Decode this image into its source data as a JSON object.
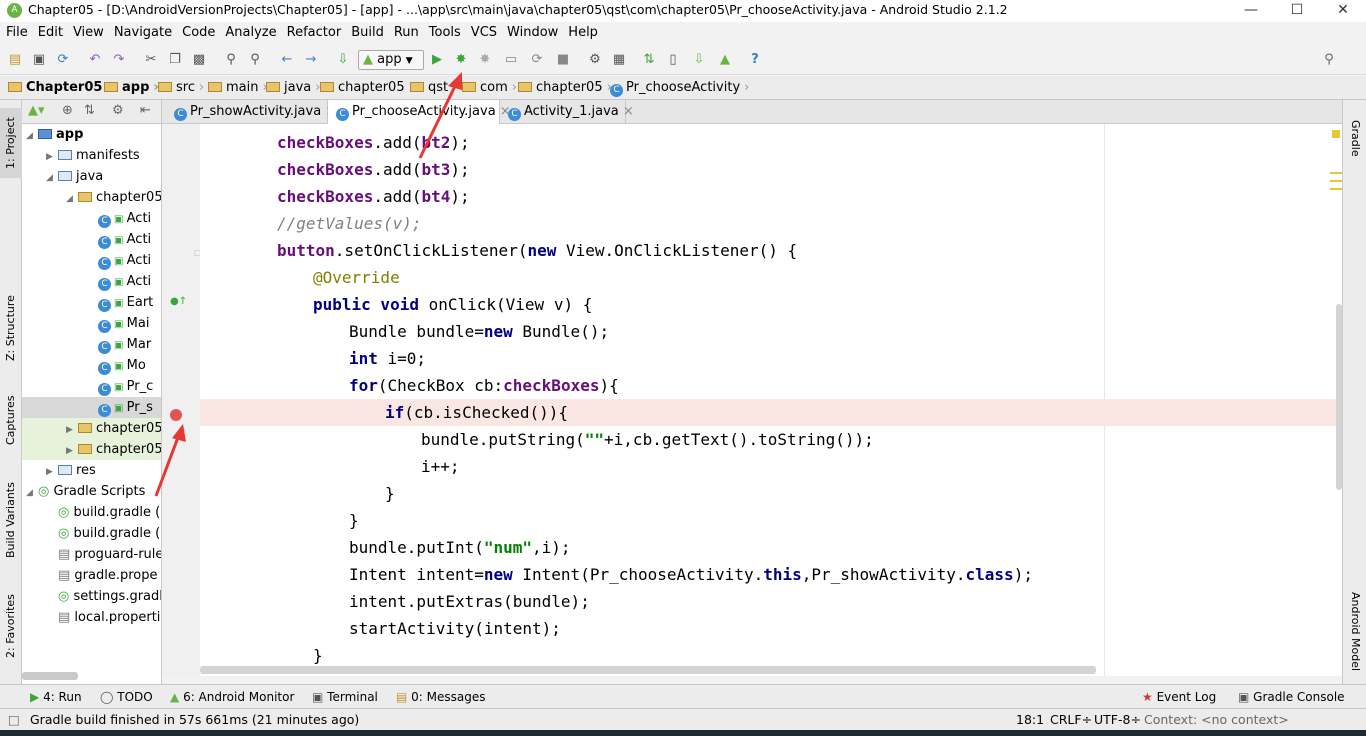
{
  "window": {
    "title": "Chapter05 - [D:\\AndroidVersionProjects\\Chapter05] - [app] - ...\\app\\src\\main\\java\\chapter05\\qst\\com\\chapter05\\Pr_chooseActivity.java - Android Studio 2.1.2",
    "minimize": "—",
    "maximize": "☐",
    "close": "✕"
  },
  "menu": [
    "File",
    "Edit",
    "View",
    "Navigate",
    "Code",
    "Analyze",
    "Refactor",
    "Build",
    "Run",
    "Tools",
    "VCS",
    "Window",
    "Help"
  ],
  "toolbar": {
    "run_config": "app"
  },
  "breadcrumb": [
    "Chapter05",
    "app",
    "src",
    "main",
    "java",
    "chapter05",
    "qst",
    "com",
    "chapter05",
    "Pr_chooseActivity"
  ],
  "left_tabs": [
    "1: Project",
    "Z: Structure",
    "Captures",
    "Build Variants",
    "2: Favorites"
  ],
  "right_tabs": [
    "Gradle",
    "Android Model"
  ],
  "project_tree": [
    {
      "label": "app",
      "depth": 0,
      "kind": "module",
      "expanded": true
    },
    {
      "label": "manifests",
      "depth": 1,
      "kind": "folder",
      "expanded": false
    },
    {
      "label": "java",
      "depth": 1,
      "kind": "folder",
      "expanded": true
    },
    {
      "label": "chapter05",
      "depth": 2,
      "kind": "package",
      "expanded": true
    },
    {
      "label": "Acti",
      "depth": 3,
      "kind": "class"
    },
    {
      "label": "Acti",
      "depth": 3,
      "kind": "class"
    },
    {
      "label": "Acti",
      "depth": 3,
      "kind": "class"
    },
    {
      "label": "Acti",
      "depth": 3,
      "kind": "class"
    },
    {
      "label": "Eart",
      "depth": 3,
      "kind": "class"
    },
    {
      "label": "Mai",
      "depth": 3,
      "kind": "class"
    },
    {
      "label": "Mar",
      "depth": 3,
      "kind": "class"
    },
    {
      "label": "Mo",
      "depth": 3,
      "kind": "class"
    },
    {
      "label": "Pr_c",
      "depth": 3,
      "kind": "class"
    },
    {
      "label": "Pr_s",
      "depth": 3,
      "kind": "class",
      "selected": true
    },
    {
      "label": "chapter05",
      "depth": 2,
      "kind": "package",
      "expanded": false
    },
    {
      "label": "chapter05",
      "depth": 2,
      "kind": "package",
      "expanded": false
    },
    {
      "label": "res",
      "depth": 1,
      "kind": "folder",
      "expanded": false
    },
    {
      "label": "Gradle Scripts",
      "depth": 0,
      "kind": "gradle",
      "expanded": true
    },
    {
      "label": "build.gradle (",
      "depth": 1,
      "kind": "gradlefile"
    },
    {
      "label": "build.gradle (",
      "depth": 1,
      "kind": "gradlefile"
    },
    {
      "label": "proguard-rule",
      "depth": 1,
      "kind": "file"
    },
    {
      "label": "gradle.prope",
      "depth": 1,
      "kind": "file"
    },
    {
      "label": "settings.gradl",
      "depth": 1,
      "kind": "gradlefile"
    },
    {
      "label": "local.properti",
      "depth": 1,
      "kind": "file"
    }
  ],
  "editor_tabs": [
    {
      "label": "Pr_showActivity.java",
      "active": false
    },
    {
      "label": "Pr_chooseActivity.java",
      "active": true
    },
    {
      "label": "Activity_1.java",
      "active": false
    }
  ],
  "code_lines": [
    {
      "indent": 2,
      "parts": [
        [
          "fld",
          "checkBoxes"
        ],
        [
          "",
          "."
        ],
        [
          "",
          "add("
        ],
        [
          "fld",
          "bt2"
        ],
        [
          "",
          ");"
        ]
      ]
    },
    {
      "indent": 2,
      "parts": [
        [
          "fld",
          "checkBoxes"
        ],
        [
          "",
          "."
        ],
        [
          "",
          "add("
        ],
        [
          "fld",
          "bt3"
        ],
        [
          "",
          ");"
        ]
      ]
    },
    {
      "indent": 2,
      "parts": [
        [
          "fld",
          "checkBoxes"
        ],
        [
          "",
          "."
        ],
        [
          "",
          "add("
        ],
        [
          "fld",
          "bt4"
        ],
        [
          "",
          ");"
        ]
      ]
    },
    {
      "indent": 2,
      "parts": [
        [
          "cm",
          "//getValues(v);"
        ]
      ]
    },
    {
      "indent": 2,
      "parts": [
        [
          "fld",
          "button"
        ],
        [
          "",
          ".setOnClickListener("
        ],
        [
          "kw",
          "new "
        ],
        [
          "",
          "View.OnClickListener() {"
        ]
      ]
    },
    {
      "indent": 3,
      "parts": [
        [
          "an",
          "@Override"
        ]
      ]
    },
    {
      "indent": 3,
      "parts": [
        [
          "kw",
          "public void "
        ],
        [
          "",
          "onClick(View v) {"
        ]
      ]
    },
    {
      "indent": 4,
      "parts": [
        [
          "",
          "Bundle bundle="
        ],
        [
          "kw",
          "new "
        ],
        [
          "",
          "Bundle();"
        ]
      ]
    },
    {
      "indent": 4,
      "parts": [
        [
          "kw",
          "int "
        ],
        [
          "",
          "i=0;"
        ]
      ]
    },
    {
      "indent": 4,
      "parts": [
        [
          "kw",
          "for"
        ],
        [
          "",
          "(CheckBox cb:"
        ],
        [
          "fld",
          "checkBoxes"
        ],
        [
          "",
          "){"
        ]
      ]
    },
    {
      "indent": 5,
      "parts": [
        [
          "kw",
          "if"
        ],
        [
          "",
          "(cb.isChecked()){"
        ]
      ],
      "breakpoint": true
    },
    {
      "indent": 6,
      "parts": [
        [
          "",
          "bundle.putString("
        ],
        [
          "str",
          "\"\""
        ],
        [
          "",
          "+i,cb.getText().toString());"
        ]
      ]
    },
    {
      "indent": 6,
      "parts": [
        [
          "",
          "i++;"
        ]
      ]
    },
    {
      "indent": 5,
      "parts": [
        [
          "",
          "}"
        ]
      ]
    },
    {
      "indent": 4,
      "parts": [
        [
          "",
          "}"
        ]
      ]
    },
    {
      "indent": 4,
      "parts": [
        [
          "",
          "bundle.putInt("
        ],
        [
          "str",
          "\"num\""
        ],
        [
          "",
          ",i);"
        ]
      ]
    },
    {
      "indent": 4,
      "parts": [
        [
          "",
          "Intent intent="
        ],
        [
          "kw",
          "new "
        ],
        [
          "",
          "Intent(Pr_chooseActivity."
        ],
        [
          "kw",
          "this"
        ],
        [
          "",
          ",Pr_showActivity."
        ],
        [
          "kw",
          "class"
        ],
        [
          "",
          ");"
        ]
      ]
    },
    {
      "indent": 4,
      "parts": [
        [
          "",
          "intent.putExtras(bundle);"
        ]
      ]
    },
    {
      "indent": 4,
      "parts": [
        [
          "",
          "startActivity(intent);"
        ]
      ]
    },
    {
      "indent": 3,
      "parts": [
        [
          "",
          "}"
        ]
      ]
    }
  ],
  "bottom_tools": {
    "run": "4: Run",
    "todo": "TODO",
    "monitor": "6: Android Monitor",
    "terminal": "Terminal",
    "messages": "0: Messages",
    "event_log": "Event Log",
    "gradle_console": "Gradle Console"
  },
  "status": {
    "message": "Gradle build finished in 57s 661ms (21 minutes ago)",
    "position": "18:1",
    "line_sep": "CRLF÷",
    "encoding": "UTF-8÷",
    "context": "Context: <no context>"
  },
  "colors": {
    "breakpoint": "#e05555",
    "annotation_arrow": "#e53935",
    "run_green": "#3aa53a"
  }
}
